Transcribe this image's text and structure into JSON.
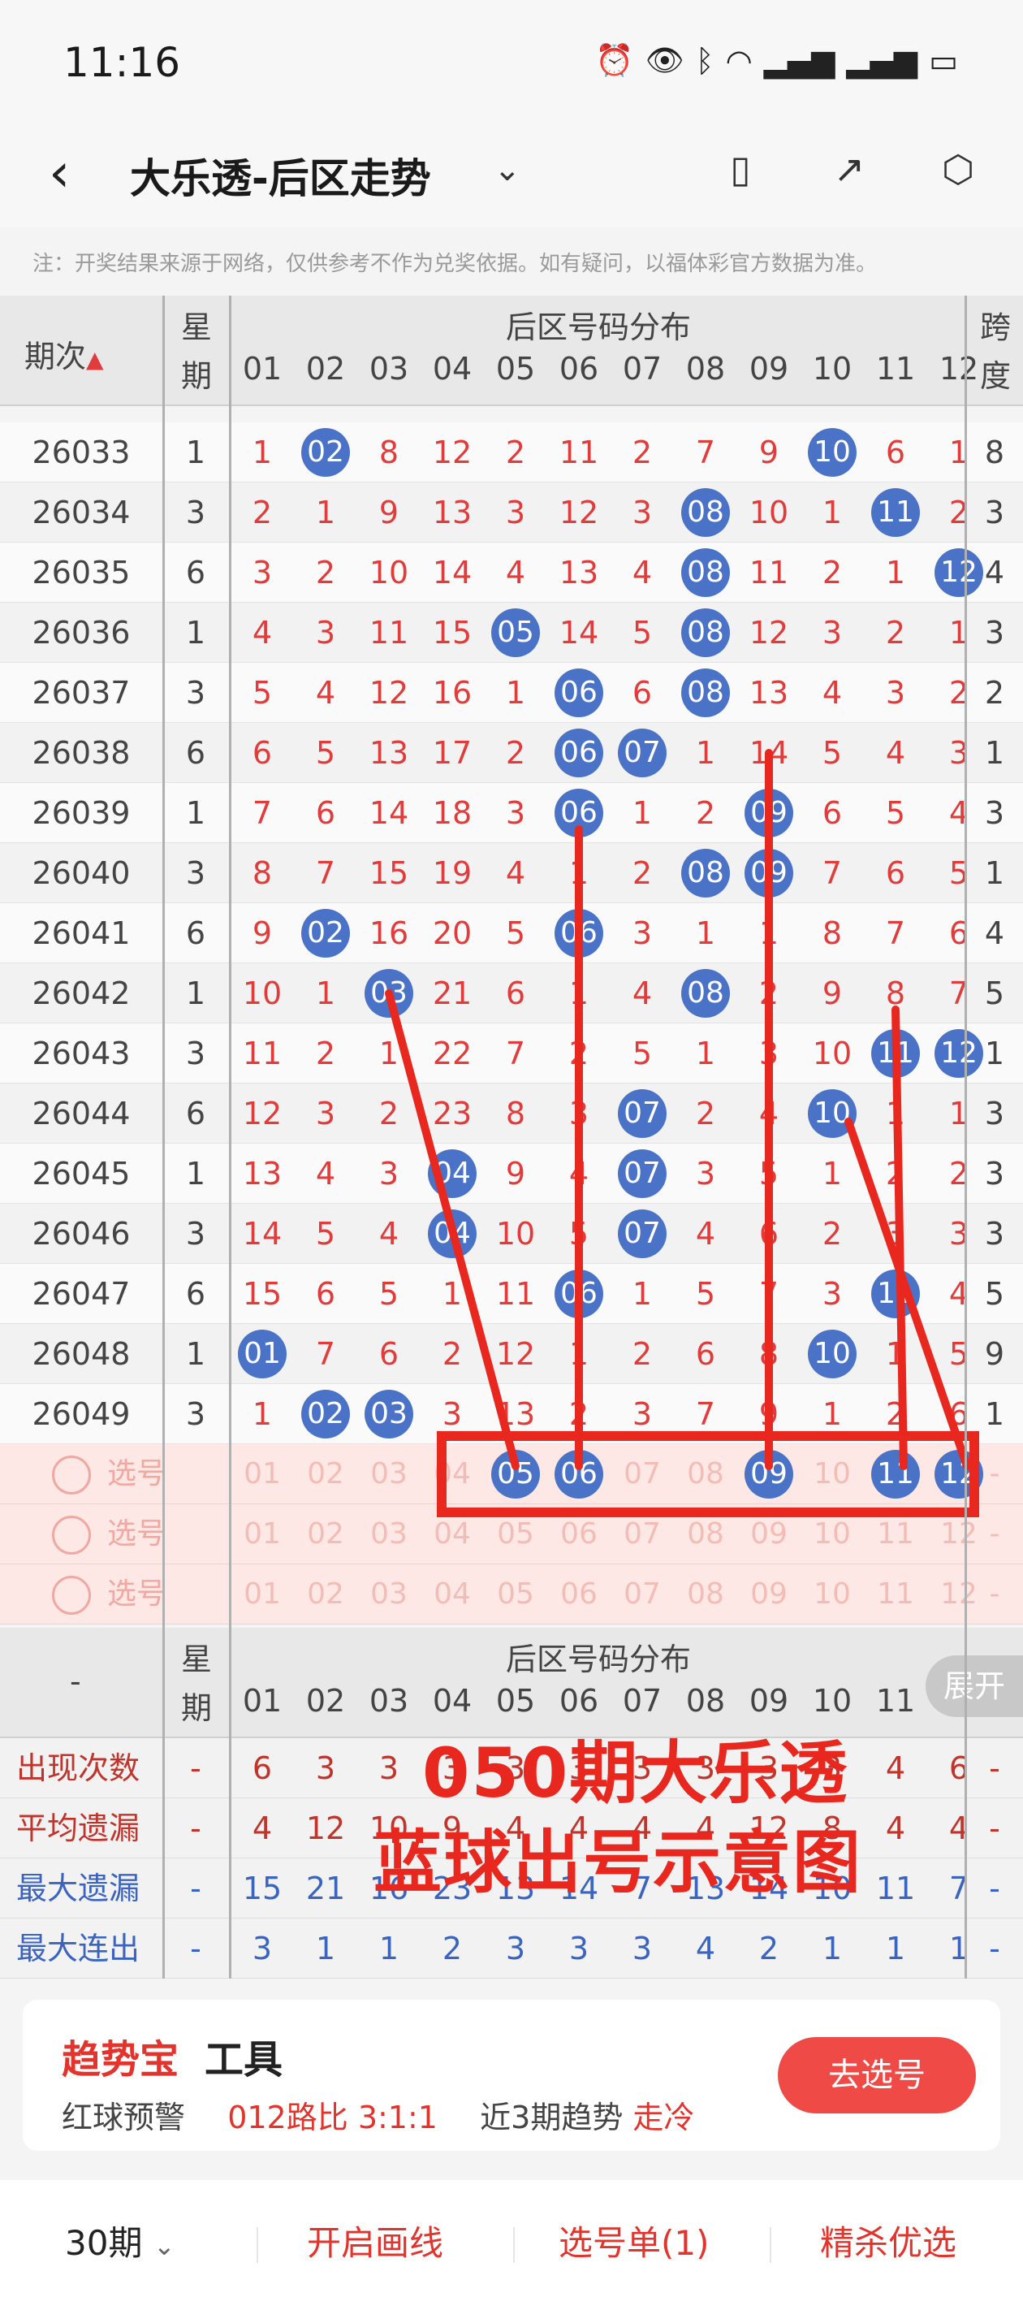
{
  "status": {
    "time": "11:16"
  },
  "nav": {
    "title": "大乐透-后区走势"
  },
  "notice": "注：开奖结果来源于网络，仅供参考不作为兑奖依据。如有疑问，以福体彩官方数据为准。",
  "table_header": {
    "issue": "期次",
    "week_l1": "星",
    "week_l2": "期",
    "dist": "后区号码分布",
    "span_l1": "跨",
    "span_l2": "度",
    "numbers": [
      "01",
      "02",
      "03",
      "04",
      "05",
      "06",
      "07",
      "08",
      "09",
      "10",
      "11",
      "12"
    ]
  },
  "rows": [
    {
      "issue": "26033",
      "week": "1",
      "cells": [
        "1",
        "02",
        "8",
        "12",
        "2",
        "11",
        "2",
        "7",
        "9",
        "10",
        "6",
        "1"
      ],
      "balls": [
        1,
        9
      ],
      "span": "8"
    },
    {
      "issue": "26034",
      "week": "3",
      "cells": [
        "2",
        "1",
        "9",
        "13",
        "3",
        "12",
        "3",
        "08",
        "10",
        "1",
        "11",
        "2"
      ],
      "balls": [
        7,
        10
      ],
      "span": "3"
    },
    {
      "issue": "26035",
      "week": "6",
      "cells": [
        "3",
        "2",
        "10",
        "14",
        "4",
        "13",
        "4",
        "08",
        "11",
        "2",
        "1",
        "12"
      ],
      "balls": [
        7,
        11
      ],
      "span": "4"
    },
    {
      "issue": "26036",
      "week": "1",
      "cells": [
        "4",
        "3",
        "11",
        "15",
        "05",
        "14",
        "5",
        "08",
        "12",
        "3",
        "2",
        "1"
      ],
      "balls": [
        4,
        7
      ],
      "span": "3"
    },
    {
      "issue": "26037",
      "week": "3",
      "cells": [
        "5",
        "4",
        "12",
        "16",
        "1",
        "06",
        "6",
        "08",
        "13",
        "4",
        "3",
        "2"
      ],
      "balls": [
        5,
        7
      ],
      "span": "2"
    },
    {
      "issue": "26038",
      "week": "6",
      "cells": [
        "6",
        "5",
        "13",
        "17",
        "2",
        "06",
        "07",
        "1",
        "14",
        "5",
        "4",
        "3"
      ],
      "balls": [
        5,
        6
      ],
      "span": "1"
    },
    {
      "issue": "26039",
      "week": "1",
      "cells": [
        "7",
        "6",
        "14",
        "18",
        "3",
        "06",
        "1",
        "2",
        "09",
        "6",
        "5",
        "4"
      ],
      "balls": [
        5,
        8
      ],
      "span": "3"
    },
    {
      "issue": "26040",
      "week": "3",
      "cells": [
        "8",
        "7",
        "15",
        "19",
        "4",
        "1",
        "2",
        "08",
        "09",
        "7",
        "6",
        "5"
      ],
      "balls": [
        7,
        8
      ],
      "span": "1"
    },
    {
      "issue": "26041",
      "week": "6",
      "cells": [
        "9",
        "02",
        "16",
        "20",
        "5",
        "06",
        "3",
        "1",
        "1",
        "8",
        "7",
        "6"
      ],
      "balls": [
        1,
        5
      ],
      "span": "4"
    },
    {
      "issue": "26042",
      "week": "1",
      "cells": [
        "10",
        "1",
        "03",
        "21",
        "6",
        "1",
        "4",
        "08",
        "2",
        "9",
        "8",
        "7"
      ],
      "balls": [
        2,
        7
      ],
      "span": "5"
    },
    {
      "issue": "26043",
      "week": "3",
      "cells": [
        "11",
        "2",
        "1",
        "22",
        "7",
        "2",
        "5",
        "1",
        "3",
        "10",
        "11",
        "12"
      ],
      "balls": [
        10,
        11
      ],
      "span": "1"
    },
    {
      "issue": "26044",
      "week": "6",
      "cells": [
        "12",
        "3",
        "2",
        "23",
        "8",
        "3",
        "07",
        "2",
        "4",
        "10",
        "1",
        "1"
      ],
      "balls": [
        6,
        9
      ],
      "span": "3"
    },
    {
      "issue": "26045",
      "week": "1",
      "cells": [
        "13",
        "4",
        "3",
        "04",
        "9",
        "4",
        "07",
        "3",
        "5",
        "1",
        "2",
        "2"
      ],
      "balls": [
        3,
        6
      ],
      "span": "3"
    },
    {
      "issue": "26046",
      "week": "3",
      "cells": [
        "14",
        "5",
        "4",
        "04",
        "10",
        "5",
        "07",
        "4",
        "6",
        "2",
        "3",
        "3"
      ],
      "balls": [
        3,
        6
      ],
      "span": "3"
    },
    {
      "issue": "26047",
      "week": "6",
      "cells": [
        "15",
        "6",
        "5",
        "1",
        "11",
        "06",
        "1",
        "5",
        "7",
        "3",
        "11",
        "4"
      ],
      "balls": [
        5,
        10
      ],
      "span": "5"
    },
    {
      "issue": "26048",
      "week": "1",
      "cells": [
        "01",
        "7",
        "6",
        "2",
        "12",
        "1",
        "2",
        "6",
        "8",
        "10",
        "1",
        "5"
      ],
      "balls": [
        0,
        9
      ],
      "span": "9"
    },
    {
      "issue": "26049",
      "week": "3",
      "cells": [
        "1",
        "02",
        "03",
        "3",
        "13",
        "2",
        "3",
        "7",
        "9",
        "1",
        "2",
        "6"
      ],
      "balls": [
        1,
        2
      ],
      "span": "1"
    }
  ],
  "pick_rows": [
    {
      "label": "选号",
      "selected": [
        4,
        5,
        8,
        10,
        11
      ],
      "span": "-"
    },
    {
      "label": "选号",
      "selected": [],
      "span": "-"
    },
    {
      "label": "选号",
      "selected": [],
      "span": "-"
    }
  ],
  "stats_header": {
    "dash": "-",
    "dist": "后区号码分布"
  },
  "expand": "展开",
  "stats": [
    {
      "label": "出现次数",
      "color": "#c0342c",
      "week": "-",
      "values": [
        "6",
        "3",
        "3",
        "3",
        "3",
        "3",
        "3",
        "3",
        "3",
        "3",
        "4",
        "6"
      ],
      "span": "-"
    },
    {
      "label": "平均遗漏",
      "color": "#c0342c",
      "week": "-",
      "values": [
        "4",
        "12",
        "10",
        "9",
        "4",
        "4",
        "4",
        "4",
        "12",
        "8",
        "4",
        "4"
      ],
      "span": "-"
    },
    {
      "label": "最大遗漏",
      "color": "#3b63c0",
      "week": "-",
      "values": [
        "15",
        "21",
        "16",
        "23",
        "13",
        "14",
        "7",
        "13",
        "14",
        "10",
        "11",
        "7"
      ],
      "span": "-"
    },
    {
      "label": "最大连出",
      "color": "#3b63c0",
      "week": "-",
      "values": [
        "3",
        "1",
        "1",
        "2",
        "3",
        "3",
        "3",
        "4",
        "2",
        "1",
        "1",
        "1"
      ],
      "span": "-"
    }
  ],
  "overlay": {
    "line1": "050期大乐透",
    "line2": "蓝球出号示意图"
  },
  "card": {
    "brand": "趋势宝",
    "tool": "工具",
    "warn": "红球预警",
    "ratio": "012路比 3:1:1",
    "trend_label": "近3期趋势",
    "trend": "走冷",
    "button": "去选号"
  },
  "bottom": {
    "period": "30期",
    "draw": "开启画线",
    "list": "选号单(1)",
    "kill": "精杀优选"
  },
  "colors": {
    "red": "#e2342c",
    "ball": "#4a73c7",
    "annotation": "#e8281f"
  }
}
